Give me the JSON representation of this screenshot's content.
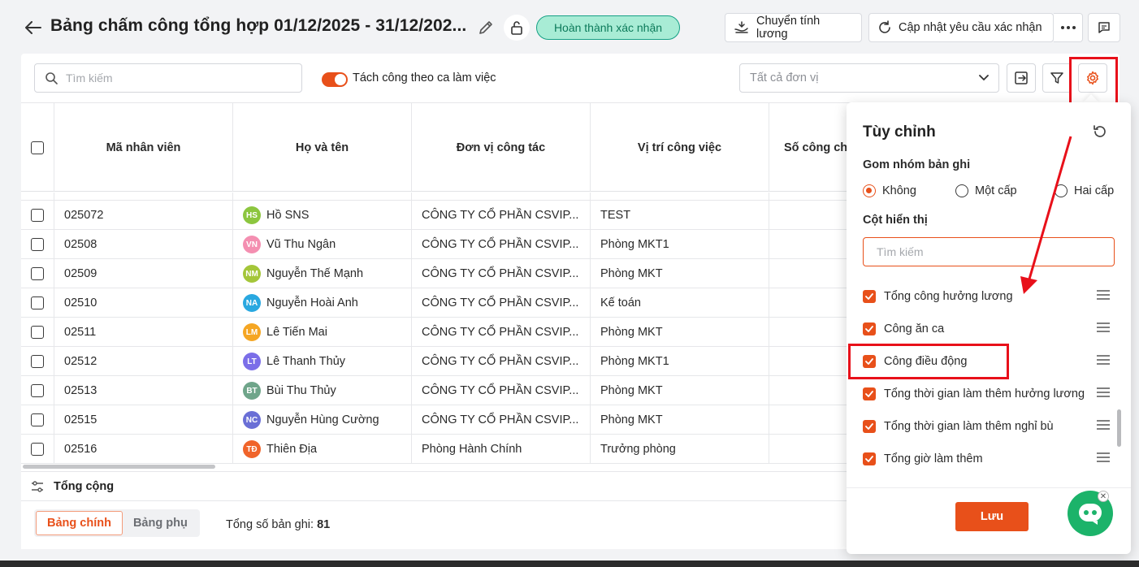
{
  "header": {
    "title": "Bảng chấm công tổng hợp 01/12/2025 - 31/12/202...",
    "status_badge": "Hoàn thành xác nhận",
    "transfer_salary_label": "Chuyển tính lương",
    "update_request_label": "Cập nhật yêu cầu xác nhận"
  },
  "toolbar": {
    "search_placeholder": "Tìm kiếm",
    "split_by_shift_label": "Tách công theo ca làm việc",
    "split_by_shift_on": true,
    "unit_select_value": "Tất cả đơn vị"
  },
  "table": {
    "columns": [
      "Mã nhân viên",
      "Họ và tên",
      "Đơn vị công tác",
      "Vị trí công việc",
      "Số công ch"
    ],
    "rows": [
      {
        "code": "025072",
        "initials": "HS",
        "avatar_color": "#8cc63f",
        "name": "Hồ SNS",
        "unit": "CÔNG TY CỔ PHẦN CSVIP...",
        "position": "TEST"
      },
      {
        "code": "02508",
        "initials": "VN",
        "avatar_color": "#f48fb1",
        "name": "Vũ Thu Ngân",
        "unit": "CÔNG TY CỔ PHẦN CSVIP...",
        "position": "Phòng MKT1"
      },
      {
        "code": "02509",
        "initials": "NM",
        "avatar_color": "#a4c639",
        "name": "Nguyễn Thế Mạnh",
        "unit": "CÔNG TY CỔ PHẦN CSVIP...",
        "position": "Phòng MKT"
      },
      {
        "code": "02510",
        "initials": "NA",
        "avatar_color": "#29a8e0",
        "name": "Nguyễn Hoài Anh",
        "unit": "CÔNG TY CỔ PHẦN CSVIP...",
        "position": "Kế toán"
      },
      {
        "code": "02511",
        "initials": "LM",
        "avatar_color": "#f5a623",
        "name": "Lê Tiến Mai",
        "unit": "CÔNG TY CỔ PHẦN CSVIP...",
        "position": "Phòng MKT"
      },
      {
        "code": "02512",
        "initials": "LT",
        "avatar_color": "#7b6ee8",
        "name": "Lê Thanh Thủy",
        "unit": "CÔNG TY CỔ PHẦN CSVIP...",
        "position": "Phòng MKT1"
      },
      {
        "code": "02513",
        "initials": "BT",
        "avatar_color": "#6fa58a",
        "name": "Bùi Thu Thủy",
        "unit": "CÔNG TY CỔ PHẦN CSVIP...",
        "position": "Phòng MKT"
      },
      {
        "code": "02515",
        "initials": "NC",
        "avatar_color": "#6a6fd6",
        "name": "Nguyễn Hùng Cường",
        "unit": "CÔNG TY CỔ PHẦN CSVIP...",
        "position": "Phòng MKT"
      },
      {
        "code": "02516",
        "initials": "TĐ",
        "avatar_color": "#f0642a",
        "name": "Thiên Địa",
        "unit": "Phòng Hành Chính",
        "position": "Trưởng phòng"
      }
    ],
    "total_label": "Tổng cộng"
  },
  "footer": {
    "tab_main": "Bảng chính",
    "tab_sub": "Bảng phụ",
    "record_count_label": "Tổng số bản ghi:",
    "record_count_value": "81"
  },
  "customize": {
    "title": "Tùy chỉnh",
    "group_label": "Gom nhóm bản ghi",
    "group_options": [
      "Không",
      "Một cấp",
      "Hai cấp"
    ],
    "group_selected": "Không",
    "columns_label": "Cột hiển thị",
    "search_placeholder": "Tìm kiếm",
    "columns": [
      "Tổng công hưởng lương",
      "Công ăn ca",
      "Công điều động",
      "Tổng thời gian làm thêm hưởng lương",
      "Tổng thời gian làm thêm nghỉ bù",
      "Tổng giờ làm thêm"
    ],
    "save_label": "Lưu"
  },
  "colors": {
    "accent": "#e8501a",
    "annotation": "#e8101a",
    "status_bg": "#a8ecd5"
  }
}
